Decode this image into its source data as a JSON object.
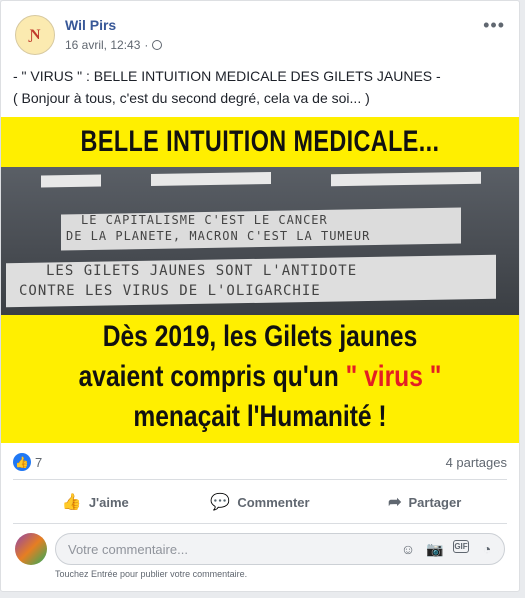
{
  "post": {
    "author": "Wil Pirs",
    "date": "16 avril, 12:43",
    "avatar_text": "Ɲ",
    "text_line1": "- \" VIRUS \" : BELLE INTUITION MEDICALE DES GILETS JAUNES -",
    "text_line2": "( Bonjour à tous, c'est du second degré, cela va de soi... )"
  },
  "image": {
    "title": "BELLE INTUITION MEDICALE...",
    "road_line1": "LE CAPITALISME C'EST LE CANCER",
    "road_line2": "DE LA PLANETE, MACRON C'EST LA TUMEUR",
    "road_line3": "LES GILETS JAUNES SONT L'ANTIDOTE",
    "road_line4": "CONTRE LES VIRUS DE L'OLIGARCHIE",
    "bottom_line1": "Dès 2019, les Gilets jaunes",
    "bottom_line2a": "avaient compris qu'un ",
    "bottom_line2b": "\" virus \"",
    "bottom_line3": "menaçait l'Humanité !"
  },
  "stats": {
    "likes": "7",
    "shares": "4 partages"
  },
  "actions": {
    "like": "J'aime",
    "comment": "Commenter",
    "share": "Partager"
  },
  "comment": {
    "placeholder": "Votre commentaire...",
    "hint": "Touchez Entrée pour publier votre commentaire."
  },
  "colors": {
    "link": "#385898",
    "accent_yellow": "#ffef00",
    "accent_red": "#e31e24",
    "like_blue": "#2078f4"
  }
}
